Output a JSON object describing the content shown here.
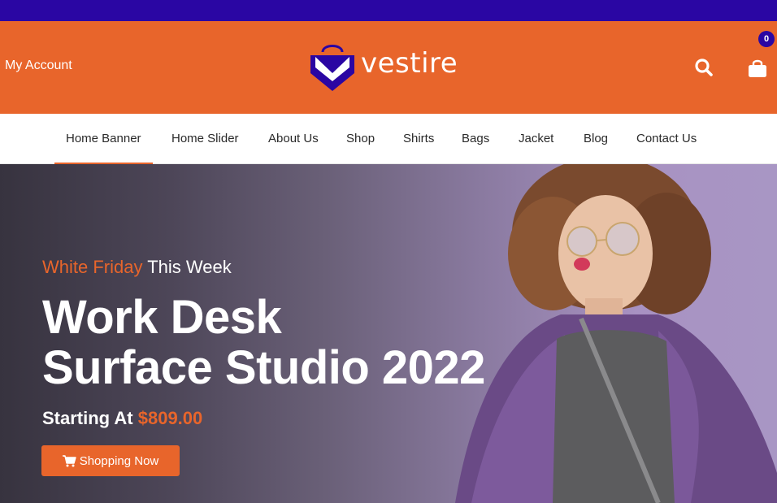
{
  "header": {
    "account_label": "My Account",
    "logo_text": "vestire",
    "cart_count": "0"
  },
  "nav": {
    "items": [
      {
        "label": "Home Banner",
        "active": true
      },
      {
        "label": "Home Slider"
      },
      {
        "label": "About Us"
      },
      {
        "label": "Shop"
      },
      {
        "label": "Shirts"
      },
      {
        "label": "Bags"
      },
      {
        "label": "Jacket"
      },
      {
        "label": "Blog"
      },
      {
        "label": "Contact Us"
      }
    ]
  },
  "hero": {
    "subtitle_accent": "White Friday",
    "subtitle_rest": " This Week",
    "title_line1": "Work Desk",
    "title_line2": "Surface Studio 2022",
    "price_prefix": "Starting At ",
    "price": "$809.00",
    "cta_label": "Shopping Now"
  },
  "colors": {
    "topbar": "#2a06a3",
    "header": "#e8652b",
    "accent": "#e8652b",
    "brand_purple": "#2a06a3"
  },
  "icons": {
    "search": "search-icon",
    "cart": "shopping-bag-icon",
    "cta": "cart-icon"
  }
}
